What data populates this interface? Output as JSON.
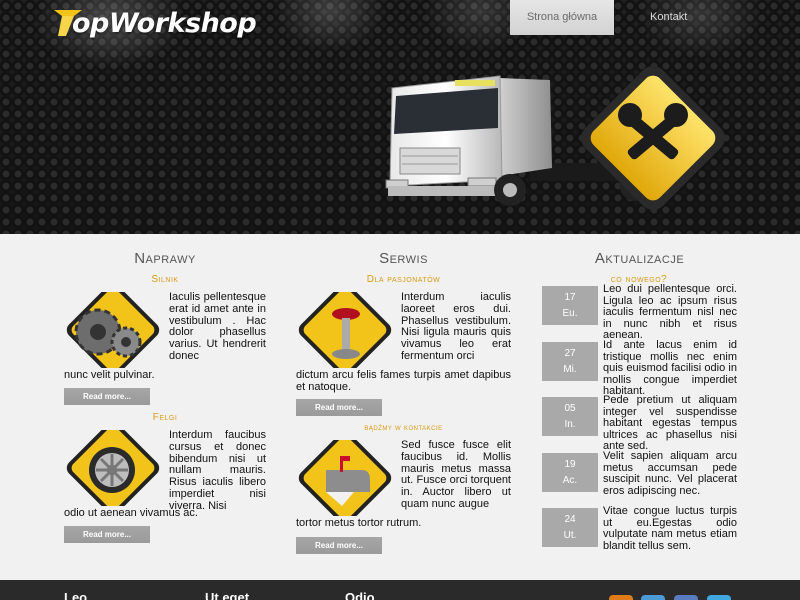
{
  "header": {
    "logo_text": "opWorkshop",
    "nav": [
      {
        "label": "Strona główna"
      },
      {
        "label": "Kontakt"
      }
    ]
  },
  "columns": {
    "naprawy": {
      "title": "Naprawy",
      "items": [
        {
          "subtitle": "Silnik",
          "icon": "gears-icon",
          "text": "Iaculis pellentesque erat id amet ante in vestibulum . Hac dolor phasellus varius. Ut hendrerit donec",
          "tail": "nunc velit pulvinar.",
          "button": "Read more..."
        },
        {
          "subtitle": "Felgi",
          "icon": "rim-icon",
          "text": "Interdum faucibus cursus et donec bibendum nisi ut nullam mauris. Risus iaculis libero imperdiet nisi viverra. Nisi",
          "tail": "odio ut aenean vivamus ac.",
          "button": "Read more..."
        }
      ]
    },
    "serwis": {
      "title": "Serwis",
      "items": [
        {
          "subtitle": "Dla pasjonatów",
          "icon": "stool-icon",
          "text": "Interdum iaculis laoreet eros dui. Phasellus vestibulum. Nisi ligula mauris quis vivamus leo erat fermentum orci",
          "tail": "dictum arcu felis fames turpis amet dapibus et natoque.",
          "button": "Read more..."
        },
        {
          "subtitle": "bądźmy w kontakcie",
          "icon": "mailbox-icon",
          "text": "Sed fusce fusce elit faucibus id. Mollis mauris metus massa ut. Fusce orci torquent in. Auctor libero ut quam nunc augue",
          "tail": "tortor metus tortor rutrum.",
          "button": "Read more..."
        }
      ]
    },
    "aktualizacje": {
      "title": "Aktualizacje",
      "subtitle": "co nowego?",
      "news": [
        {
          "day": "17",
          "month": "Eu.",
          "text": "Leo dui pellentesque orci. Ligula leo ac ipsum risus iaculis fermentum nisl nec in nunc nibh et risus aenean."
        },
        {
          "day": "27",
          "month": "Mi.",
          "text": "Id ante lacus enim id tristique mollis nec enim quis euismod facilisi odio in mollis congue imperdiet habitant."
        },
        {
          "day": "05",
          "month": "In.",
          "text": "Pede pretium ut aliquam integer vel suspendisse habitant egestas tempus ultrices ac phasellus nisi ante sed."
        },
        {
          "day": "19",
          "month": "Ac.",
          "text": "Velit sapien aliquam arcu metus accumsan pede suscipit nunc. Vel placerat eros adipiscing nec."
        },
        {
          "day": "24",
          "month": "Ut.",
          "text": "Vitae congue luctus turpis ut eu.Egestas odio vulputate nam metus etiam blandit tellus sem."
        }
      ]
    }
  },
  "footer": {
    "headings": [
      "Leo",
      "Ut eget",
      "Odio"
    ],
    "social_colors": [
      "#e07b1a",
      "#4a9bd8",
      "#5b7bc0",
      "#3fa9e0"
    ]
  },
  "colors": {
    "accent": "#d89a14",
    "button": "#a0a0a0",
    "badge_yellow": "#f2c318"
  }
}
